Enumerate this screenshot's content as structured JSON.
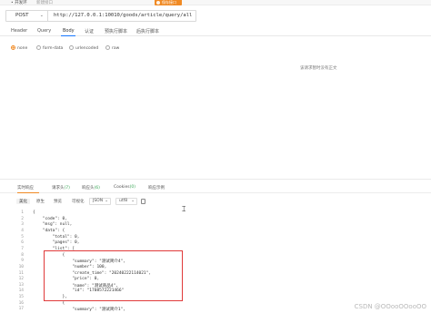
{
  "topbar": {
    "env": "• 开发环",
    "env_sub": "新建接口",
    "btn": "保存接口"
  },
  "request": {
    "method": "POST",
    "url": "http://127.0.0.1:10010/goods/article/query/all"
  },
  "tabs": [
    "Header",
    "Query",
    "Body",
    "认证",
    "预执行脚本",
    "后执行脚本"
  ],
  "body_types": [
    "none",
    "form-data",
    "urlencoded",
    "raw"
  ],
  "empty_msg": "该请求暂时没有正文",
  "response_tabs": [
    {
      "label": "实时响应",
      "count": ""
    },
    {
      "label": "请求头",
      "count": "(7)"
    },
    {
      "label": "响应头",
      "count": "(6)"
    },
    {
      "label": "Cookies",
      "count": "(0)"
    },
    {
      "label": "响应示例",
      "count": ""
    }
  ],
  "response_toolbar": {
    "b1": "美化",
    "b2": "原生",
    "b3": "预览",
    "b4": "可视化",
    "format": "JSON",
    "encoding": "utf8"
  },
  "code_lines": [
    {
      "n": "1",
      "t": "{"
    },
    {
      "n": "2",
      "t": "    \"code\": 0,"
    },
    {
      "n": "3",
      "t": "    \"msg\": null,"
    },
    {
      "n": "4",
      "t": "    \"data\": {"
    },
    {
      "n": "5",
      "t": "        \"total\": 0,"
    },
    {
      "n": "6",
      "t": "        \"pages\": 0,"
    },
    {
      "n": "7",
      "t": "        \"list\": ["
    },
    {
      "n": "8",
      "t": "            {"
    },
    {
      "n": "9",
      "t": "                \"summary\": \"测试简介4\","
    },
    {
      "n": "10",
      "t": "                \"number\": 100,"
    },
    {
      "n": "11",
      "t": "                \"create_time\": \"20240222114021\","
    },
    {
      "n": "12",
      "t": "                \"price\": 0,"
    },
    {
      "n": "13",
      "t": "                \"name\": \"测试商品4\","
    },
    {
      "n": "14",
      "t": "                \"id\": \"1708572221466\""
    },
    {
      "n": "15",
      "t": "            },"
    },
    {
      "n": "16",
      "t": "            {"
    },
    {
      "n": "17",
      "t": "                \"summary\": \"测试简介1\","
    }
  ],
  "watermark": "CSDN @OOooOOooOO"
}
